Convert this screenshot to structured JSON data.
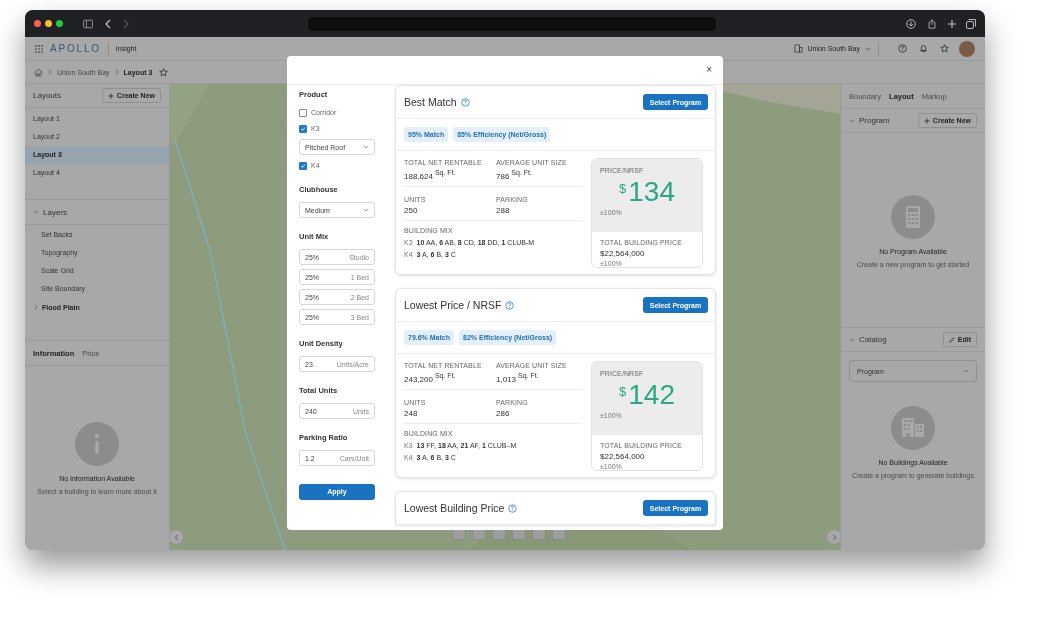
{
  "app_header": {
    "brand": "APOLLO",
    "product": "Insight",
    "project": "Union South Bay"
  },
  "breadcrumb": [
    {
      "label": "Union South Bay"
    },
    {
      "label": "Layout 3"
    }
  ],
  "left_panel": {
    "layouts": {
      "title": "Layouts",
      "button": "Create New",
      "items": [
        {
          "label": "Layout 1",
          "selected": false
        },
        {
          "label": "Layout 2",
          "selected": false
        },
        {
          "label": "Layout 3",
          "selected": true
        },
        {
          "label": "Layout 4",
          "selected": false
        }
      ]
    },
    "layers": {
      "title": "Layers",
      "expanded": true,
      "items": [
        {
          "label": "Set Backs",
          "kind": "layer"
        },
        {
          "label": "Topography",
          "kind": "layer"
        },
        {
          "label": "Scale Grid",
          "kind": "layer"
        },
        {
          "label": "Site Boundary",
          "kind": "layer"
        },
        {
          "label": "Flood Plain",
          "kind": "group",
          "expanded": false
        }
      ]
    },
    "info_tabs": [
      {
        "label": "Information",
        "selected": true
      },
      {
        "label": "Price",
        "selected": false
      }
    ],
    "empty": {
      "title": "No Information Available",
      "subtitle": "Select a building to learn more about it"
    }
  },
  "right_panel": {
    "tabs": [
      {
        "label": "Boundary",
        "selected": false
      },
      {
        "label": "Layout",
        "selected": true
      },
      {
        "label": "Markup",
        "selected": false
      }
    ],
    "program": {
      "title": "Program",
      "expanded": true,
      "button": "Create New",
      "empty": {
        "title": "No Program Available",
        "subtitle": "Create a new program to get started"
      }
    },
    "catalog": {
      "title": "Catalog",
      "expanded": true,
      "button": "Edit",
      "select": "Program",
      "empty": {
        "title": "No Buildings Available",
        "subtitle": "Create a program to generate buildings"
      }
    }
  },
  "modal": {
    "close": "×",
    "form": [
      {
        "kind": "checks",
        "title": "Product",
        "items": [
          {
            "label": "Corridor",
            "checked": false
          },
          {
            "label": "K3",
            "checked": true,
            "select": "Pitched Roof"
          },
          {
            "label": "K4",
            "checked": true
          }
        ]
      },
      {
        "kind": "select",
        "title": "Clubhouse",
        "value": "Medium"
      },
      {
        "kind": "inputs",
        "title": "Unit Mix",
        "fields": [
          {
            "value": "25%",
            "unit": "Studio"
          },
          {
            "value": "25%",
            "unit": "1 Bed"
          },
          {
            "value": "25%",
            "unit": "2 Bed"
          },
          {
            "value": "25%",
            "unit": "3 Bed"
          }
        ]
      },
      {
        "kind": "inputs",
        "title": "Unit Density",
        "fields": [
          {
            "value": "23",
            "unit": "Units/Acre"
          }
        ]
      },
      {
        "kind": "inputs",
        "title": "Total Units",
        "fields": [
          {
            "value": "240",
            "unit": "Units"
          }
        ]
      },
      {
        "kind": "inputs",
        "title": "Parking Ratio",
        "fields": [
          {
            "value": "1.2",
            "unit": "Cars/Unit"
          }
        ]
      }
    ],
    "apply": "Apply",
    "cards": [
      {
        "title": "Best Match",
        "button": "Select Program",
        "tags": [
          "95% Match",
          "85% Efficiency (Net/Gross)"
        ],
        "stats": [
          {
            "label": "TOTAL NET RENTABLE",
            "value": "188,624",
            "unit": "Sq. Ft."
          },
          {
            "label": "AVERAGE UNIT SIZE",
            "value": "786",
            "unit": "Sq. Ft."
          },
          {
            "label": "UNITS",
            "value": "250"
          },
          {
            "label": "PARKING",
            "value": "288"
          }
        ],
        "mix_label": "BUILDING MIX",
        "mix": [
          {
            "type": "K3",
            "text": "**10** AA, **6** AB, **8** CD, **18** DD, **1** CLUB-M"
          },
          {
            "type": "K4",
            "text": "**3** A, **6** B, **3** C"
          }
        ],
        "price": {
          "label": "PRICE/NRSF",
          "currency": "$",
          "value": "134",
          "note": "±100%"
        },
        "total": {
          "label": "TOTAL BUILDING PRICE",
          "value": "$22,564,000",
          "note": "±100%"
        }
      },
      {
        "title": "Lowest Price / NRSF",
        "button": "Select Program",
        "tags": [
          "79.6% Match",
          "82% Efficiency (Net/Gross)"
        ],
        "stats": [
          {
            "label": "TOTAL NET RENTABLE",
            "value": "243,200",
            "unit": "Sq. Ft."
          },
          {
            "label": "AVERAGE UNIT SIZE",
            "value": "1,013",
            "unit": "Sq. Ft."
          },
          {
            "label": "UNITS",
            "value": "248"
          },
          {
            "label": "PARKING",
            "value": "286"
          }
        ],
        "mix_label": "BUILDING MIX",
        "mix": [
          {
            "type": "K3",
            "text": "**13** FF, **18** AA, **21** AF, **1** CLUB–M"
          },
          {
            "type": "K4",
            "text": "**3** A, **6** B, **3** C"
          }
        ],
        "price": {
          "label": "PRICE/NRSF",
          "currency": "$",
          "value": "142",
          "note": "±100%"
        },
        "total": {
          "label": "TOTAL BUILDING PRICE",
          "value": "$22,564,000",
          "note": "±100%"
        }
      },
      {
        "title": "Lowest Building Price",
        "button": "Select Program"
      }
    ]
  }
}
